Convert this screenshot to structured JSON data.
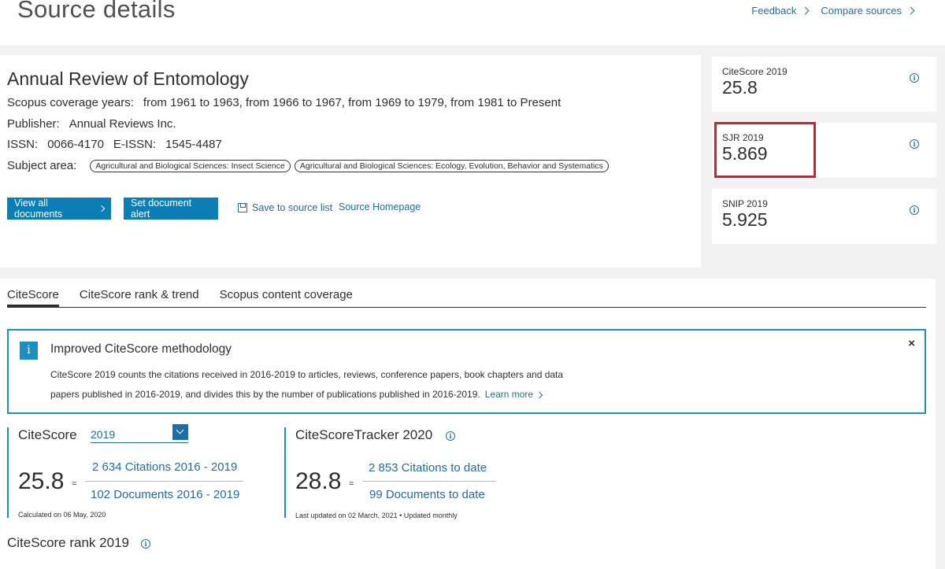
{
  "header": {
    "title": "Source details",
    "feedback": "Feedback",
    "compare": "Compare sources"
  },
  "source": {
    "title": "Annual Review of Entomology",
    "coverage_label": "Scopus coverage years:",
    "coverage_value": "from 1961 to 1963, from 1966 to 1967, from 1969 to 1979, from 1981 to Present",
    "publisher_label": "Publisher:",
    "publisher_value": "Annual Reviews Inc.",
    "issn_label": "ISSN:",
    "issn_value": "0066-4170",
    "eissn_label": "E-ISSN:",
    "eissn_value": "1545-4487",
    "subject_label": "Subject area:",
    "subjects": [
      "Agricultural and Biological Sciences: Insect Science",
      "Agricultural and Biological Sciences: Ecology, Evolution, Behavior and Systematics"
    ]
  },
  "actions": {
    "view_all": "View all documents",
    "set_alert": "Set document alert",
    "save_list": "Save to source list",
    "homepage": "Source Homepage"
  },
  "metrics": [
    {
      "label": "CiteScore 2019",
      "value": "25.8"
    },
    {
      "label": "SJR 2019",
      "value": "5.869"
    },
    {
      "label": "SNIP 2019",
      "value": "5.925"
    }
  ],
  "tabs": [
    "CiteScore",
    "CiteScore rank & trend",
    "Scopus content coverage"
  ],
  "notice": {
    "icon": "i",
    "title": "Improved CiteScore methodology",
    "line1": "CiteScore 2019 counts the citations received in 2016-2019 to articles, reviews, conference papers, book chapters and data",
    "line2": "papers published in 2016-2019, and divides this by the number of publications published in 2016-2019.",
    "learn_more": "Learn more",
    "close": "×"
  },
  "citescore": {
    "title": "CiteScore",
    "year": "2019",
    "value": "25.8",
    "eq": "=",
    "citations": "2 634 Citations 2016 - 2019",
    "documents": "102 Documents 2016 - 2019",
    "calc_note": "Calculated on 06 May, 2020"
  },
  "tracker": {
    "title": "CiteScoreTracker 2020",
    "value": "28.8",
    "eq": "=",
    "citations": "2 853 Citations to date",
    "documents": "99 Documents to date",
    "note": "Last updated on 02 March, 2021 • Updated monthly"
  },
  "rank": {
    "title": "CiteScore rank 2019"
  },
  "colors": {
    "accent": "#0c7db5",
    "link": "#1f6d9b",
    "highlight": "#d71e28"
  }
}
